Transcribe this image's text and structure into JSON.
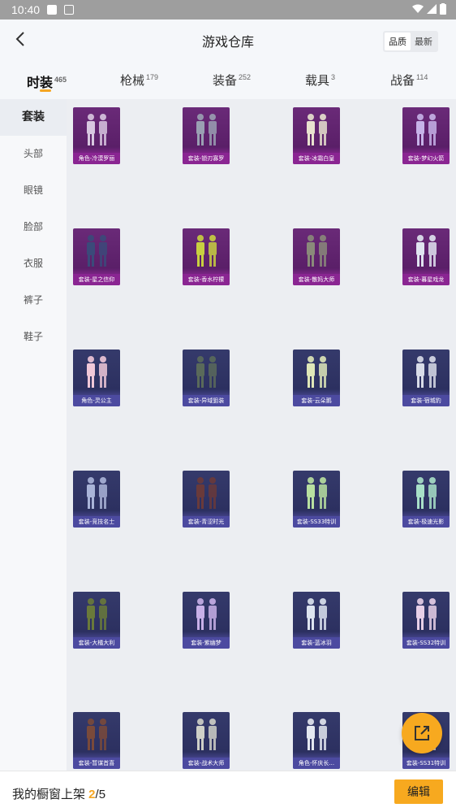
{
  "status_bar": {
    "time": "10:40"
  },
  "header": {
    "title": "游戏仓库",
    "sort_options": [
      "品质",
      "最新"
    ],
    "sort_active": "品质"
  },
  "tabs": [
    {
      "label": "时装",
      "count": "465"
    },
    {
      "label": "枪械",
      "count": "179"
    },
    {
      "label": "装备",
      "count": "252"
    },
    {
      "label": "载具",
      "count": "3"
    },
    {
      "label": "战备",
      "count": "114"
    }
  ],
  "sidebar": [
    "套装",
    "头部",
    "眼镜",
    "脸部",
    "衣服",
    "裤子",
    "鞋子"
  ],
  "items": [
    {
      "label": "角色-冷漠罗丽",
      "rarity": "purple"
    },
    {
      "label": "套装-锁刃寡罗",
      "rarity": "purple"
    },
    {
      "label": "套装-冰霜白皇",
      "rarity": "purple"
    },
    {
      "label": "套装-梦幻火箭",
      "rarity": "purple"
    },
    {
      "label": "套装-星之信仰",
      "rarity": "purple"
    },
    {
      "label": "套装-香水柠檬",
      "rarity": "purple"
    },
    {
      "label": "套装-散妈大师",
      "rarity": "purple"
    },
    {
      "label": "套装-暮星戏龙",
      "rarity": "purple"
    },
    {
      "label": "角色-灵公主",
      "rarity": "blue"
    },
    {
      "label": "套装-异域狙装",
      "rarity": "blue"
    },
    {
      "label": "套装-云朵鹅",
      "rarity": "blue"
    },
    {
      "label": "套装-宿城豹",
      "rarity": "blue"
    },
    {
      "label": "套装-竞技名士",
      "rarity": "blue"
    },
    {
      "label": "套装-青涩时光",
      "rarity": "blue"
    },
    {
      "label": "套装-SS33特训",
      "rarity": "blue"
    },
    {
      "label": "套装-极速光影",
      "rarity": "blue"
    },
    {
      "label": "套装-大橘大利",
      "rarity": "blue"
    },
    {
      "label": "套装-紫幽梦",
      "rarity": "blue"
    },
    {
      "label": "套装-蓝冰羽",
      "rarity": "blue"
    },
    {
      "label": "套装-SS32特训",
      "rarity": "blue"
    },
    {
      "label": "套装-暂谋首喜",
      "rarity": "blue"
    },
    {
      "label": "套装-战术大师",
      "rarity": "blue"
    },
    {
      "label": "角色-怀庆长...",
      "rarity": "blue"
    },
    {
      "label": "套装-SS31特训",
      "rarity": "blue"
    }
  ],
  "bottom": {
    "prefix": "我的橱窗上架 ",
    "current": "2",
    "separator": "/",
    "total": "5",
    "edit": "编辑"
  }
}
